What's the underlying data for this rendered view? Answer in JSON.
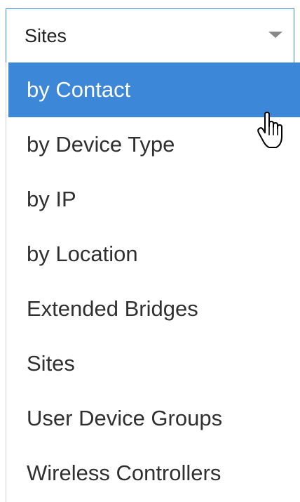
{
  "dropdown": {
    "selected": "Sites",
    "active_option": "by Contact",
    "options": [
      "by Contact",
      "by Device Type",
      "by IP",
      "by Location",
      "Extended Bridges",
      "Sites",
      "User Device Groups",
      "Wireless Controllers"
    ]
  },
  "colors": {
    "accent": "#3d87d8",
    "border": "#3a86d6"
  },
  "icons": {
    "caret": "chevron-down-icon",
    "cursor": "hand-pointer-icon"
  }
}
